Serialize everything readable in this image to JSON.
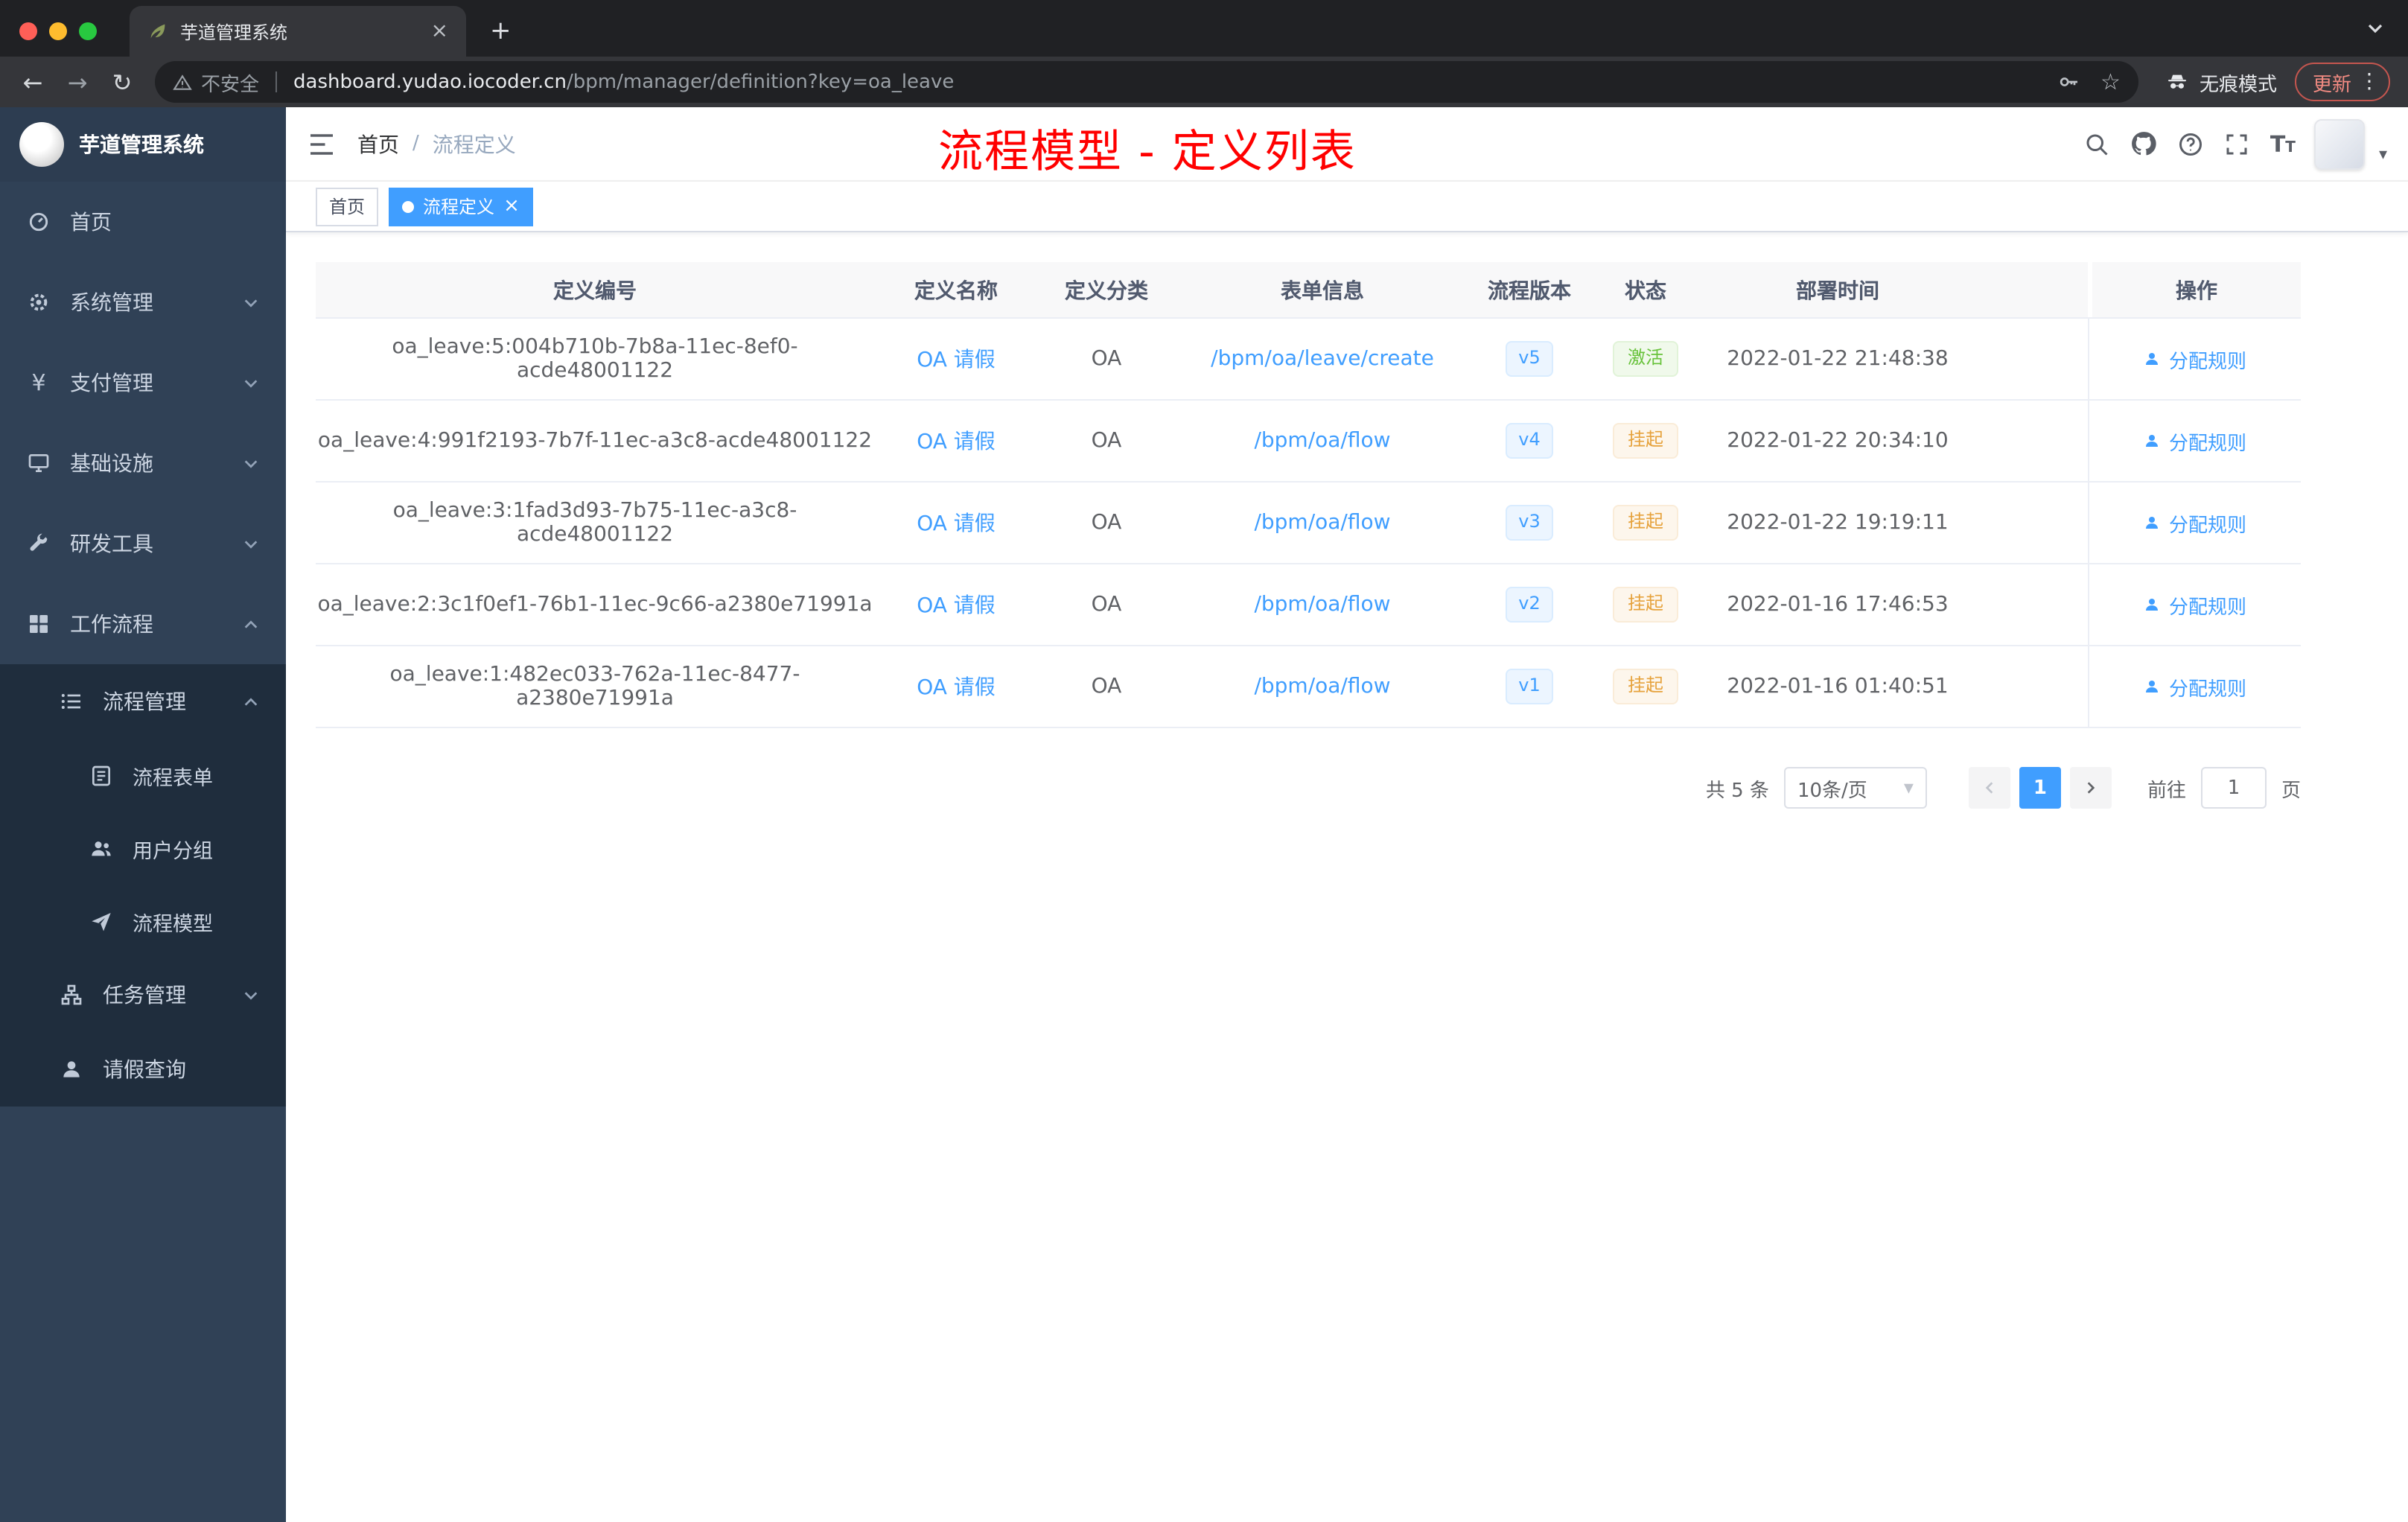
{
  "browser": {
    "tab": {
      "title": "芋道管理系统"
    },
    "address": {
      "security_label": "不安全",
      "host": "dashboard.yudao.iocoder.cn",
      "path": "/bpm/manager/definition?key=oa_leave"
    },
    "incognito_label": "无痕模式",
    "update_label": "更新"
  },
  "sidebar": {
    "logo_title": "芋道管理系统",
    "items": [
      {
        "label": "首页",
        "icon": "dashboard-icon"
      },
      {
        "label": "系统管理",
        "icon": "gear-icon"
      },
      {
        "label": "支付管理",
        "icon": "payment-icon"
      },
      {
        "label": "基础设施",
        "icon": "infrastructure-icon"
      },
      {
        "label": "研发工具",
        "icon": "tools-icon"
      },
      {
        "label": "工作流程",
        "icon": "workflow-icon"
      },
      {
        "label": "流程管理",
        "icon": "process-list-icon"
      },
      {
        "label": "流程表单",
        "icon": "form-icon"
      },
      {
        "label": "用户分组",
        "icon": "user-group-icon"
      },
      {
        "label": "流程模型",
        "icon": "process-model-icon"
      },
      {
        "label": "任务管理",
        "icon": "task-icon"
      },
      {
        "label": "请假查询",
        "icon": "leave-icon"
      }
    ]
  },
  "header": {
    "breadcrumb": [
      "首页",
      "流程定义"
    ],
    "annotation": "流程模型 - 定义列表"
  },
  "tags": [
    {
      "label": "首页",
      "active": false
    },
    {
      "label": "流程定义",
      "active": true
    }
  ],
  "table": {
    "columns": [
      "定义编号",
      "定义名称",
      "定义分类",
      "表单信息",
      "流程版本",
      "状态",
      "部署时间",
      "操作"
    ],
    "action_label": "分配规则",
    "rows": [
      {
        "id": "oa_leave:5:004b710b-7b8a-11ec-8ef0-acde48001122",
        "name": "OA 请假",
        "category": "OA",
        "form": "/bpm/oa/leave/create",
        "version": "v5",
        "status": "激活",
        "status_type": "success",
        "deploy_time": "2022-01-22 21:48:38"
      },
      {
        "id": "oa_leave:4:991f2193-7b7f-11ec-a3c8-acde48001122",
        "name": "OA 请假",
        "category": "OA",
        "form": "/bpm/oa/flow",
        "version": "v4",
        "status": "挂起",
        "status_type": "warning",
        "deploy_time": "2022-01-22 20:34:10"
      },
      {
        "id": "oa_leave:3:1fad3d93-7b75-11ec-a3c8-acde48001122",
        "name": "OA 请假",
        "category": "OA",
        "form": "/bpm/oa/flow",
        "version": "v3",
        "status": "挂起",
        "status_type": "warning",
        "deploy_time": "2022-01-22 19:19:11"
      },
      {
        "id": "oa_leave:2:3c1f0ef1-76b1-11ec-9c66-a2380e71991a",
        "name": "OA 请假",
        "category": "OA",
        "form": "/bpm/oa/flow",
        "version": "v2",
        "status": "挂起",
        "status_type": "warning",
        "deploy_time": "2022-01-16 17:46:53"
      },
      {
        "id": "oa_leave:1:482ec033-762a-11ec-8477-a2380e71991a",
        "name": "OA 请假",
        "category": "OA",
        "form": "/bpm/oa/flow",
        "version": "v1",
        "status": "挂起",
        "status_type": "warning",
        "deploy_time": "2022-01-16 01:40:51"
      }
    ]
  },
  "pagination": {
    "total_label": "共 5 条",
    "page_size_label": "10条/页",
    "current_page": "1",
    "goto_label": "前往",
    "goto_value": "1",
    "page_unit_label": "页"
  },
  "colors": {
    "accent": "#409eff",
    "success": "#67c23a",
    "warning": "#e6a23c",
    "annotation": "#ff0000",
    "sidebar_bg": "#304156",
    "submenu_bg": "#1f2d3d"
  }
}
